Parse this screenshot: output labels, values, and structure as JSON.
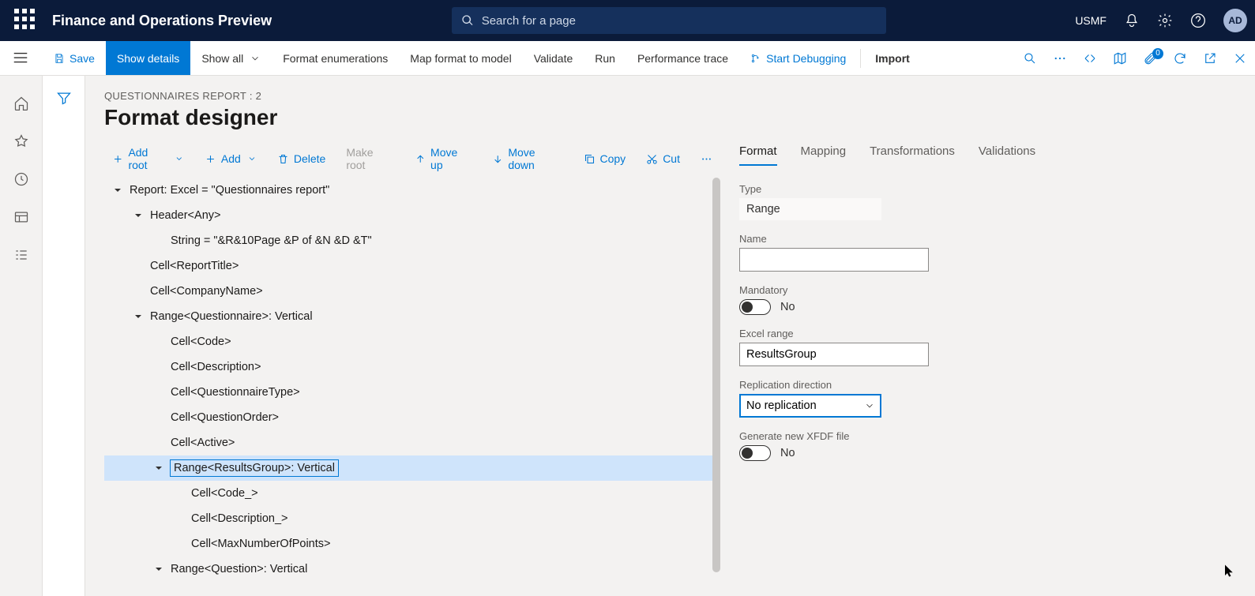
{
  "app_title": "Finance and Operations Preview",
  "search_placeholder": "Search for a page",
  "company": "USMF",
  "avatar": "AD",
  "commands": {
    "save": "Save",
    "show_details": "Show details",
    "show_all": "Show all",
    "format_enum": "Format enumerations",
    "map_format": "Map format to model",
    "validate": "Validate",
    "run": "Run",
    "perf_trace": "Performance trace",
    "start_debug": "Start Debugging",
    "import": "Import"
  },
  "attach_badge": "0",
  "breadcrumb": "QUESTIONNAIRES REPORT : 2",
  "page_title": "Format designer",
  "tree_toolbar": {
    "add_root": "Add root",
    "add": "Add",
    "delete": "Delete",
    "make_root": "Make root",
    "move_up": "Move up",
    "move_down": "Move down",
    "copy": "Copy",
    "cut": "Cut"
  },
  "tree": [
    {
      "indent": 0,
      "expander": "open",
      "label": "Report: Excel = \"Questionnaires report\""
    },
    {
      "indent": 1,
      "expander": "open",
      "label": "Header<Any>"
    },
    {
      "indent": 2,
      "expander": "",
      "label": "String = \"&R&10Page &P of &N &D &T\""
    },
    {
      "indent": 1,
      "expander": "",
      "label": "Cell<ReportTitle>"
    },
    {
      "indent": 1,
      "expander": "",
      "label": "Cell<CompanyName>"
    },
    {
      "indent": 1,
      "expander": "open",
      "label": "Range<Questionnaire>: Vertical"
    },
    {
      "indent": 2,
      "expander": "",
      "label": "Cell<Code>"
    },
    {
      "indent": 2,
      "expander": "",
      "label": "Cell<Description>"
    },
    {
      "indent": 2,
      "expander": "",
      "label": "Cell<QuestionnaireType>"
    },
    {
      "indent": 2,
      "expander": "",
      "label": "Cell<QuestionOrder>"
    },
    {
      "indent": 2,
      "expander": "",
      "label": "Cell<Active>"
    },
    {
      "indent": 2,
      "expander": "open",
      "label": "Range<ResultsGroup>: Vertical",
      "selected": true,
      "row_indent": 1
    },
    {
      "indent": 3,
      "expander": "",
      "label": "Cell<Code_>"
    },
    {
      "indent": 3,
      "expander": "",
      "label": "Cell<Description_>"
    },
    {
      "indent": 3,
      "expander": "",
      "label": "Cell<MaxNumberOfPoints>"
    },
    {
      "indent": 2,
      "expander": "open",
      "label": "Range<Question>: Vertical"
    }
  ],
  "tabs": {
    "format": "Format",
    "mapping": "Mapping",
    "transformations": "Transformations",
    "validations": "Validations"
  },
  "form": {
    "type_label": "Type",
    "type_value": "Range",
    "name_label": "Name",
    "name_value": "",
    "mandatory_label": "Mandatory",
    "mandatory_value": "No",
    "excel_range_label": "Excel range",
    "excel_range_value": "ResultsGroup",
    "replication_label": "Replication direction",
    "replication_value": "No replication",
    "xfdf_label": "Generate new XFDF file",
    "xfdf_value": "No"
  }
}
